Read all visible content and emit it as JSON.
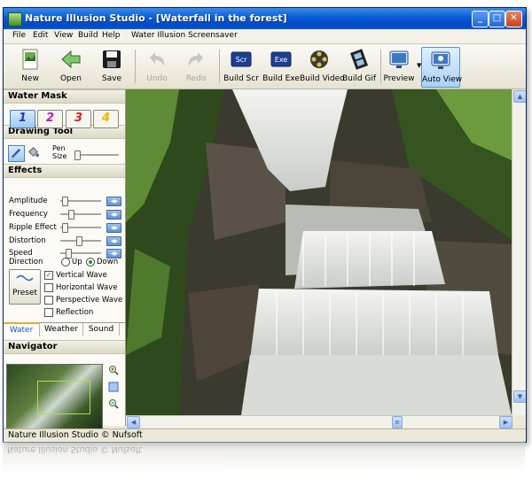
{
  "window": {
    "title": "Nature Illusion Studio - [Waterfall in the forest]",
    "controls": {
      "minimize": "_",
      "maximize": "□",
      "close": "✕"
    }
  },
  "menu": [
    "File",
    "Edit",
    "View",
    "Build",
    "Help",
    "Water Illusion Screensaver"
  ],
  "toolbar": {
    "new": "New",
    "open": "Open",
    "save": "Save",
    "undo": "Undo",
    "redo": "Redo",
    "build_scr": "Build Scr",
    "build_exe": "Build Exe",
    "build_video": "Build Video",
    "build_gif": "Build Gif",
    "preview": "Preview",
    "auto_view": "Auto View",
    "scr_badge": "Scr",
    "exe_badge": "Exe"
  },
  "water_mask": {
    "title": "Water Mask",
    "masks": [
      {
        "label": "1",
        "color": "#1a3cc4"
      },
      {
        "label": "2",
        "color": "#b81fb8"
      },
      {
        "label": "3",
        "color": "#d42020"
      },
      {
        "label": "4",
        "color": "#e8b800"
      }
    ],
    "selected": 1
  },
  "drawing_tool": {
    "title": "Drawing Tool",
    "pen_size_label": "Pen\nSize",
    "pen_size_level": 0.0
  },
  "effects": {
    "title": "Effects",
    "sliders": [
      {
        "label": "Amplitude",
        "level": 0.05
      },
      {
        "label": "Frequency",
        "level": 0.22
      },
      {
        "label": "Ripple Effect",
        "level": 0.05
      },
      {
        "label": "Distortion",
        "level": 0.45
      },
      {
        "label": "Speed",
        "level": 0.15
      }
    ],
    "direction": {
      "label": "Direction",
      "options": [
        "Up",
        "Down"
      ],
      "selected": "Down"
    },
    "preset_label": "Preset",
    "checkboxes": [
      {
        "label": "Vertical Wave",
        "checked": true
      },
      {
        "label": "Horizontal Wave",
        "checked": false
      },
      {
        "label": "Perspective Wave",
        "checked": false
      },
      {
        "label": "Reflection",
        "checked": false
      }
    ]
  },
  "tabs": [
    "Water",
    "Weather",
    "Sound"
  ],
  "navigator": {
    "title": "Navigator"
  },
  "status": {
    "text": "Nature Illusion Studio © Nufsoft"
  },
  "colors": {
    "title_bar": "#0a5bd6",
    "panel": "#ece9d8",
    "accent": "#1b4fb0"
  }
}
